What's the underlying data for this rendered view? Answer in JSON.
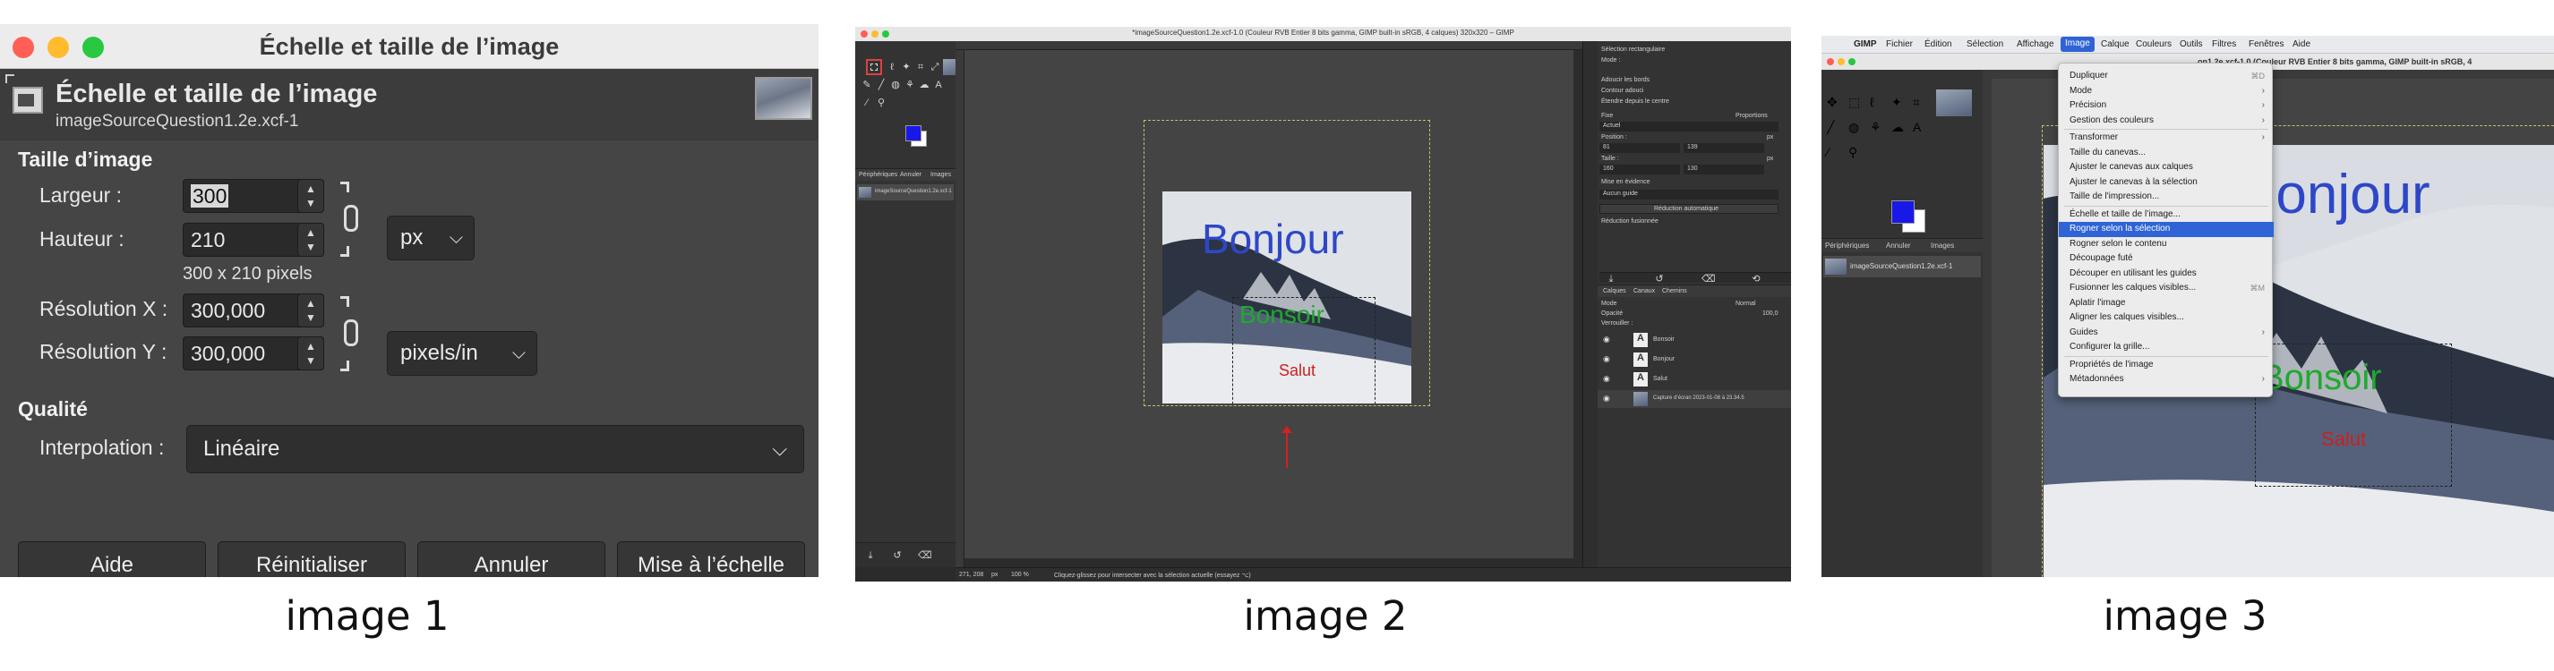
{
  "captions": {
    "c1": "image 1",
    "c2": "image 2",
    "c3": "image 3"
  },
  "colors": {
    "gimp_dark": "#454545",
    "selection_blue": "#2f63d6",
    "text_blue": "#2e47c8",
    "text_green": "#1faa2d",
    "text_red": "#cc1f1f"
  },
  "panel1": {
    "window_title": "Échelle et taille de l’image",
    "header_title": "Échelle et taille de l’image",
    "header_subtitle": "imageSourceQuestion1.2e.xcf-1",
    "image_size": {
      "section": "Taille d’image",
      "width_label": "Largeur :",
      "width_value": "300",
      "height_label": "Hauteur :",
      "height_value": "210",
      "pixels_note": "300 x 210 pixels",
      "unit": "px",
      "res_x_label": "Résolution X :",
      "res_x_value": "300,000",
      "res_y_label": "Résolution Y :",
      "res_y_value": "300,000",
      "res_unit": "pixels/in"
    },
    "quality": {
      "section": "Qualité",
      "interp_label": "Interpolation :",
      "interp_value": "Linéaire"
    },
    "buttons": {
      "help": "Aide",
      "reset": "Réinitialiser",
      "cancel": "Annuler",
      "scale": "Mise à l’échelle"
    }
  },
  "panel2": {
    "window_title": "*imageSourceQuestion1.2e.xcf-1.0 (Couleur RVB Entier 8 bits gamma, GIMP built-in sRGB, 4 calques) 320x320 – GIMP",
    "dock_tabs": [
      "Périphériques",
      "Annuler",
      "Images"
    ],
    "image_item": "imageSourceQuestion1.2e.xcf-1",
    "canvas_texts": {
      "bonjour": "Bonjour",
      "bonsoir": "Bonsoir",
      "salut": "Salut"
    },
    "tool_options": {
      "title": "Sélection rectangulaire",
      "mode": "Mode :",
      "antialias": "Adoucir les bords",
      "feather": "Contour adouci",
      "expand": "Étendre depuis le centre",
      "fixed": "Fixe",
      "fixed_value": "Proportions",
      "current": "Actuel",
      "position": "Position :",
      "pos_x": "81",
      "pos_y": "139",
      "size": "Taille :",
      "size_w": "160",
      "size_h": "130",
      "highlight": "Mise en évidence",
      "guides": "Aucun guide",
      "auto_shrink": "Réduction automatique",
      "shrink_merged": "Réduction fusionnée",
      "px_unit": "px"
    },
    "layers_tabs": [
      "Calques",
      "Canaux",
      "Chemins"
    ],
    "layers_header": {
      "mode_label": "Mode",
      "mode_value": "Normal",
      "opacity_label": "Opacité",
      "opacity_value": "100,0",
      "lock_label": "Verrouiller :"
    },
    "layers": [
      "Bonsoir",
      "Bonjour",
      "Salut",
      "Capture d’écran 2023-01-08 à 23.34.5"
    ],
    "status": {
      "coords": "271, 208",
      "unit": "px",
      "zoom": "100 %",
      "message": "Cliquez-glissez pour intersecter avec la sélection actuelle (essayez ⌥)"
    }
  },
  "panel3": {
    "menubar": [
      "GIMP",
      "Fichier",
      "Édition",
      "Sélection",
      "Affichage",
      "Image",
      "Calque",
      "Couleurs",
      "Outils",
      "Filtres",
      "Fenêtres",
      "Aide"
    ],
    "title_fragment": "on1.2e.xcf-1.0 (Couleur RVB Entier 8 bits gamma, GIMP built-in sRGB, 4",
    "dock_tabs": [
      "Périphériques",
      "Annuler",
      "Images"
    ],
    "image_item": "imageSourceQuestion1.2e.xcf-1",
    "canvas_texts": {
      "bonjour": "Bonjour",
      "bonsoir": "Bonsoir",
      "salut": "Salut"
    },
    "menu_items": [
      {
        "label": "Dupliquer",
        "shortcut": "⌘D",
        "arrow": ""
      },
      {
        "label": "Mode",
        "shortcut": "",
        "arrow": "›"
      },
      {
        "label": "Précision",
        "shortcut": "",
        "arrow": "›"
      },
      {
        "label": "Gestion des couleurs",
        "shortcut": "",
        "arrow": "›"
      },
      {
        "label": "Transformer",
        "shortcut": "",
        "arrow": "›"
      },
      {
        "label": "Taille du canevas...",
        "shortcut": "",
        "arrow": ""
      },
      {
        "label": "Ajuster le canevas aux calques",
        "shortcut": "",
        "arrow": ""
      },
      {
        "label": "Ajuster le canevas à la sélection",
        "shortcut": "",
        "arrow": ""
      },
      {
        "label": "Taille de l'impression...",
        "shortcut": "",
        "arrow": ""
      },
      {
        "label": "Échelle et taille de l’image...",
        "shortcut": "",
        "arrow": ""
      },
      {
        "label": "Rogner selon la sélection",
        "shortcut": "",
        "arrow": ""
      },
      {
        "label": "Rogner selon le contenu",
        "shortcut": "",
        "arrow": ""
      },
      {
        "label": "Découpage futé",
        "shortcut": "",
        "arrow": ""
      },
      {
        "label": "Découper en utilisant les guides",
        "shortcut": "",
        "arrow": ""
      },
      {
        "label": "Fusionner les calques visibles...",
        "shortcut": "⌘M",
        "arrow": ""
      },
      {
        "label": "Aplatir l'image",
        "shortcut": "",
        "arrow": ""
      },
      {
        "label": "Aligner les calques visibles...",
        "shortcut": "",
        "arrow": ""
      },
      {
        "label": "Guides",
        "shortcut": "",
        "arrow": "›"
      },
      {
        "label": "Configurer la grille...",
        "shortcut": "",
        "arrow": ""
      },
      {
        "label": "Propriétés de l'image",
        "shortcut": "",
        "arrow": ""
      },
      {
        "label": "Métadonnées",
        "shortcut": "",
        "arrow": "›"
      }
    ],
    "selected_item": "Rogner selon la sélection"
  }
}
